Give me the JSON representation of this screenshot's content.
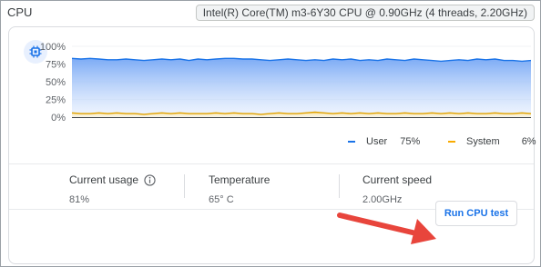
{
  "header": {
    "title": "CPU",
    "cpu_info": "Intel(R) Core(TM) m3-6Y30 CPU @ 0.90GHz (4 threads, 2.20GHz)"
  },
  "icons": {
    "chip": "cpu-chip-icon",
    "info": "info-icon"
  },
  "colors": {
    "user": "#1a73e8",
    "system": "#f9ab00",
    "accent": "#1a73e8",
    "arrow": "#e8453c"
  },
  "chart_data": {
    "type": "area",
    "ylim": [
      0,
      100
    ],
    "yticks": [
      "100%",
      "75%",
      "50%",
      "25%",
      "0%"
    ],
    "series": [
      {
        "name": "User",
        "values": [
          83,
          82,
          83,
          82,
          81,
          81,
          82,
          81,
          80,
          81,
          82,
          81,
          82,
          80,
          82,
          81,
          82,
          83,
          83,
          82,
          82,
          81,
          80,
          81,
          82,
          81,
          80,
          81,
          80,
          82,
          81,
          82,
          80,
          81,
          80,
          82,
          81,
          80,
          82,
          81,
          80,
          79,
          80,
          81,
          80,
          82,
          81,
          82,
          80,
          80,
          79,
          80
        ]
      },
      {
        "name": "System",
        "values": [
          6,
          5,
          5,
          6,
          5,
          6,
          5,
          5,
          4,
          5,
          6,
          5,
          6,
          5,
          5,
          5,
          6,
          5,
          6,
          5,
          5,
          4,
          5,
          6,
          5,
          5,
          6,
          7,
          6,
          5,
          6,
          5,
          6,
          5,
          6,
          5,
          5,
          6,
          5,
          5,
          6,
          5,
          6,
          5,
          6,
          5,
          5,
          6,
          5,
          5,
          6,
          5
        ]
      }
    ]
  },
  "legend": {
    "user_label": "User",
    "user_value": "75%",
    "system_label": "System",
    "system_value": "6%"
  },
  "stats": {
    "usage_label": "Current usage",
    "usage_value": "81%",
    "temp_label": "Temperature",
    "temp_value": "65° C",
    "speed_label": "Current speed",
    "speed_value": "2.00GHz"
  },
  "button": {
    "run_label": "Run CPU test"
  }
}
